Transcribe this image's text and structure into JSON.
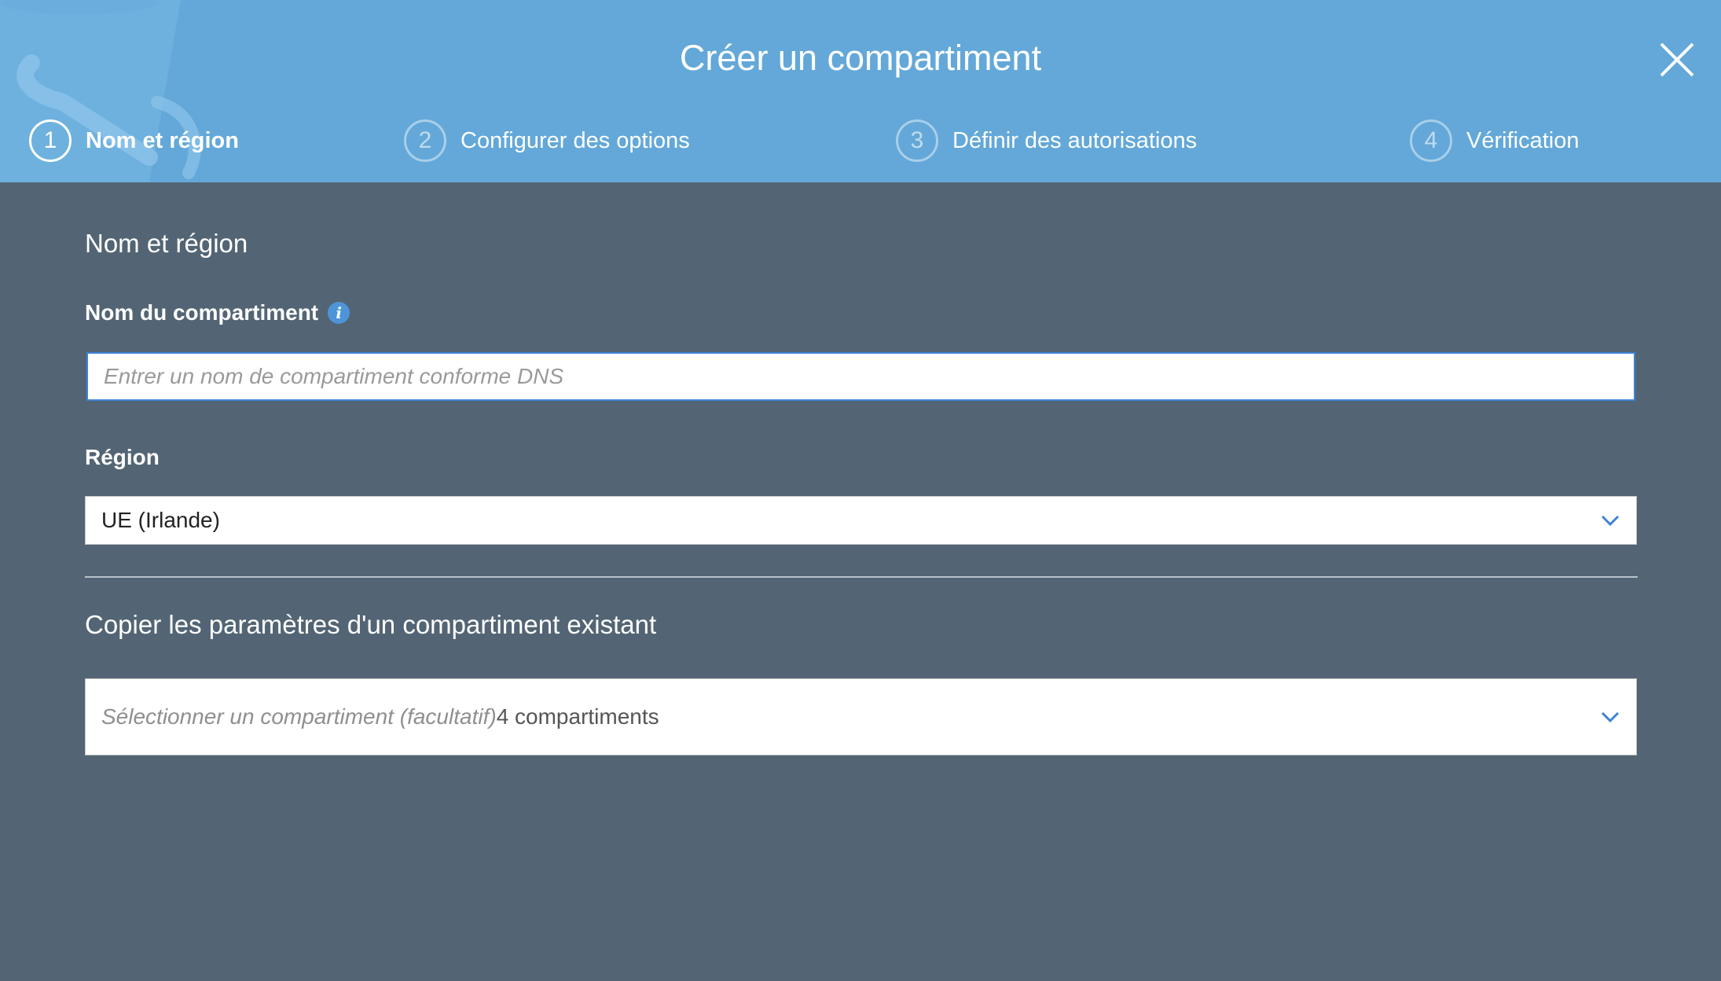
{
  "dialog": {
    "title": "Créer un compartiment",
    "close_icon": "close-icon"
  },
  "steps": [
    {
      "number": "1",
      "label": "Nom et région",
      "active": true
    },
    {
      "number": "2",
      "label": "Configurer des options",
      "active": false
    },
    {
      "number": "3",
      "label": "Définir des autorisations",
      "active": false
    },
    {
      "number": "4",
      "label": "Vérification",
      "active": false
    }
  ],
  "form": {
    "section_title": "Nom et région",
    "bucket_name": {
      "label": "Nom du compartiment",
      "info_icon": "info-icon",
      "value": "",
      "placeholder": "Entrer un nom de compartiment conforme DNS"
    },
    "region": {
      "label": "Région",
      "selected": "UE (Irlande)"
    },
    "copy_settings": {
      "title": "Copier les paramètres d'un compartiment existant",
      "placeholder": "Sélectionner un compartiment (facultatif)",
      "count": "4 compartiments"
    }
  },
  "colors": {
    "header_bg": "#63a8d8",
    "body_bg": "#536574",
    "input_focus_border": "#3d83d6",
    "chevron": "#3d83d6"
  }
}
